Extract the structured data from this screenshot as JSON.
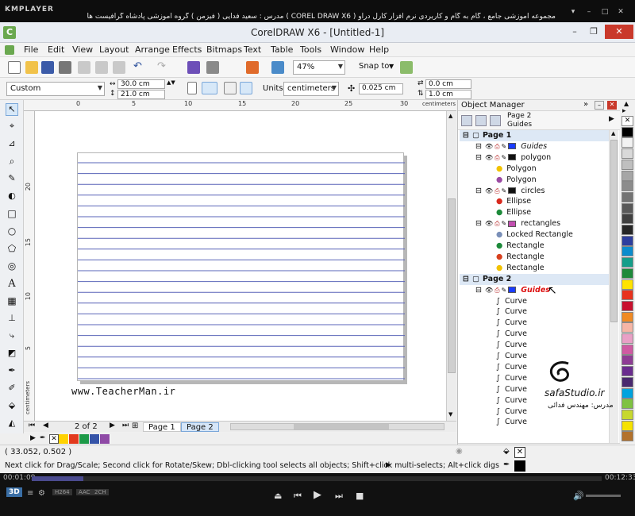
{
  "player": {
    "logo": "KMPLAYER",
    "title": "مجموعه آموزشی جامع ، گام به گام و کاربردی نرم افزار کارل دراو ( COREL DRAW X6 ) مدرس : سعید فدایی ( فیزمن ) گروه آموزشی پادشاه گرافیست ها",
    "time_elapsed": "00:01:09",
    "time_total": "00:12:33",
    "progress_fraction": 0.09,
    "badges": [
      "3D",
      "H264",
      "AAC",
      "2CH"
    ]
  },
  "app": {
    "title": "CorelDRAW X6 - [Untitled-1]",
    "logo_letter": "C"
  },
  "menu": [
    "File",
    "Edit",
    "View",
    "Layout",
    "Arrange",
    "Effects",
    "Bitmaps",
    "Text",
    "Table",
    "Tools",
    "Window",
    "Help"
  ],
  "toolbar": {
    "zoom": "47%",
    "snap_label": "Snap to"
  },
  "propbar": {
    "preset": "Custom",
    "width": "30.0 cm",
    "height": "21.0 cm",
    "units_label": "Units:",
    "units": "centimeters",
    "nudge": "0.025 cm",
    "dup_x": "0.0 cm",
    "dup_y": "1.0 cm"
  },
  "rulers": {
    "top_ticks": [
      "0",
      "5",
      "10",
      "15",
      "20",
      "25",
      "30"
    ],
    "top_unit": "centimeters",
    "left_ticks": [
      "20",
      "15",
      "10",
      "5"
    ],
    "left_unit": "centimeters"
  },
  "canvas": {
    "website": "www.TeacherMan.ir",
    "guide_count": 21,
    "watermark_name": "safaStudio.ir",
    "watermark_caption": "مدرس: مهندس فدائی"
  },
  "page_nav": {
    "counter": "2 of 2",
    "tabs": [
      "Page 1",
      "Page 2"
    ],
    "active": "Page 2"
  },
  "object_manager": {
    "title": "Object Manager",
    "current_page": "Page 2",
    "current_layer": "Guides",
    "rows": [
      {
        "kind": "page",
        "label": "Page 1"
      },
      {
        "kind": "layer",
        "label": "Guides",
        "italic": true,
        "color": "#1a3cff"
      },
      {
        "kind": "layer",
        "label": "polygon",
        "color": "#111111"
      },
      {
        "kind": "obj",
        "label": "Polygon",
        "color": "#f2c200"
      },
      {
        "kind": "obj",
        "label": "Polygon",
        "color": "#9b4aa3"
      },
      {
        "kind": "layer",
        "label": "circles",
        "color": "#111111"
      },
      {
        "kind": "obj",
        "label": "Ellipse",
        "color": "#d82a1e"
      },
      {
        "kind": "obj",
        "label": "Ellipse",
        "color": "#1d8a3a"
      },
      {
        "kind": "layer",
        "label": "rectangles",
        "color": "#c24fb0"
      },
      {
        "kind": "obj",
        "label": "Locked Rectangle",
        "color": "#7a8fb8"
      },
      {
        "kind": "obj",
        "label": "Rectangle",
        "color": "#1d8a3a"
      },
      {
        "kind": "obj",
        "label": "Rectangle",
        "color": "#d8401e"
      },
      {
        "kind": "obj",
        "label": "Rectangle",
        "color": "#f2c200"
      },
      {
        "kind": "page",
        "label": "Page 2"
      },
      {
        "kind": "layer",
        "label": "Guides",
        "italic": true,
        "red": true,
        "color": "#1a3cff"
      },
      {
        "kind": "curve",
        "label": "Curve"
      },
      {
        "kind": "curve",
        "label": "Curve"
      },
      {
        "kind": "curve",
        "label": "Curve"
      },
      {
        "kind": "curve",
        "label": "Curve"
      },
      {
        "kind": "curve",
        "label": "Curve"
      },
      {
        "kind": "curve",
        "label": "Curve"
      },
      {
        "kind": "curve",
        "label": "Curve"
      },
      {
        "kind": "curve",
        "label": "Curve"
      },
      {
        "kind": "curve",
        "label": "Curve"
      },
      {
        "kind": "curve",
        "label": "Curve"
      },
      {
        "kind": "curve",
        "label": "Curve"
      },
      {
        "kind": "curve",
        "label": "Curve"
      }
    ]
  },
  "palette_bottom": [
    "#ffd200",
    "#e23a1e",
    "#1d9a48",
    "#3554a8",
    "#8f4aa6"
  ],
  "palette_right": [
    "#ffffff",
    "#000000",
    "#f2f2f2",
    "#d9d9d9",
    "#bfbfbf",
    "#a6a6a6",
    "#8c8c8c",
    "#737373",
    "#595959",
    "#404040",
    "#262626",
    "#2d3e9e",
    "#0b8ccd",
    "#159e8a",
    "#1d8a3a",
    "#ffe300",
    "#e8321d",
    "#c8102e",
    "#f08a24",
    "#f6b6a6",
    "#e9a0c6",
    "#cf5aa2",
    "#8e3c94",
    "#6a2c8e",
    "#49286e",
    "#00a3de",
    "#7fc242",
    "#c7d82f",
    "#f6e200",
    "#b3722c"
  ],
  "status": {
    "coords": "( 33.052, 0.502 )",
    "hint": "Next click for Drag/Scale; Second click for Rotate/Skew; Dbl-clicking tool selects all objects; Shift+click multi-selects; Alt+click digs"
  }
}
